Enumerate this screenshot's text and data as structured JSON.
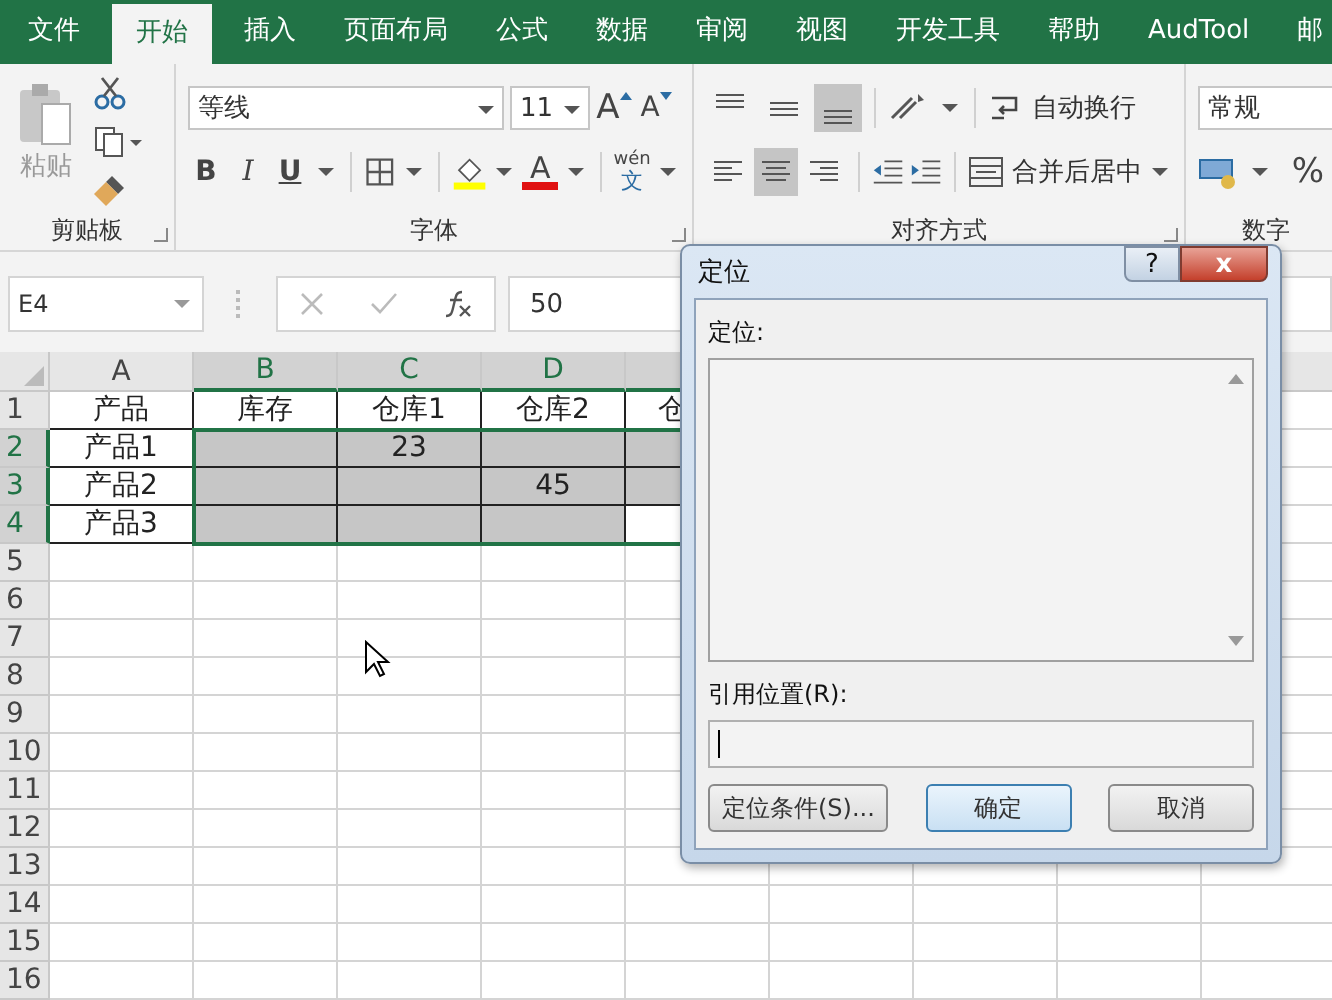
{
  "tabs": [
    {
      "label": "文件",
      "selected": false
    },
    {
      "label": "开始",
      "selected": true
    },
    {
      "label": "插入",
      "selected": false
    },
    {
      "label": "页面布局",
      "selected": false
    },
    {
      "label": "公式",
      "selected": false
    },
    {
      "label": "数据",
      "selected": false
    },
    {
      "label": "审阅",
      "selected": false
    },
    {
      "label": "视图",
      "selected": false
    },
    {
      "label": "开发工具",
      "selected": false
    },
    {
      "label": "帮助",
      "selected": false
    },
    {
      "label": "AudTool",
      "selected": false
    },
    {
      "label": "邮",
      "selected": false
    }
  ],
  "ribbon": {
    "clipboard": {
      "label": "剪贴板",
      "paste": "粘贴"
    },
    "font": {
      "label": "字体",
      "font_name": "等线",
      "font_size": "11",
      "grow": "A",
      "shrink": "A",
      "bold": "B",
      "italic": "I",
      "underline": "U",
      "font_color": "A",
      "phonetic_top": "wén",
      "phonetic_bottom": "文"
    },
    "alignment": {
      "label": "对齐方式",
      "vertical": [
        {
          "kind": "top",
          "selected": false
        },
        {
          "kind": "middle",
          "selected": false
        },
        {
          "kind": "bottom",
          "selected": true
        }
      ],
      "horizontal": [
        {
          "kind": "left",
          "selected": false
        },
        {
          "kind": "center",
          "selected": true
        },
        {
          "kind": "right",
          "selected": false
        }
      ],
      "wrap": "自动换行",
      "merge": "合并后居中"
    },
    "number": {
      "label": "数字",
      "format": "常规",
      "percent": "%"
    }
  },
  "formula_bar": {
    "name_box": "E4",
    "value": "50"
  },
  "columns": [
    {
      "label": "A",
      "selected": false
    },
    {
      "label": "B",
      "selected": true
    },
    {
      "label": "C",
      "selected": true
    },
    {
      "label": "D",
      "selected": true
    },
    {
      "selected": true
    }
  ],
  "rows": [
    {
      "number": "1",
      "selected": false,
      "cells": [
        {
          "text": "产品",
          "selected": false
        },
        {
          "text": "库存",
          "selected": false
        },
        {
          "text": "仓库1",
          "selected": false
        },
        {
          "text": "仓库2",
          "selected": false
        },
        {
          "text": "仓",
          "selected": false
        }
      ]
    },
    {
      "number": "2",
      "selected": true,
      "cells": [
        {
          "text": "产品1",
          "selected": false
        },
        {
          "selected": true
        },
        {
          "text": "23",
          "selected": true
        },
        {
          "selected": true
        },
        {
          "selected": true
        }
      ]
    },
    {
      "number": "3",
      "selected": true,
      "cells": [
        {
          "text": "产品2",
          "selected": false
        },
        {
          "selected": true
        },
        {
          "selected": true
        },
        {
          "text": "45",
          "selected": true
        },
        {
          "selected": true
        }
      ]
    },
    {
      "number": "4",
      "selected": true,
      "cells": [
        {
          "text": "产品3",
          "selected": false
        },
        {
          "selected": true
        },
        {
          "selected": true
        },
        {
          "selected": true
        },
        {
          "selected": false
        }
      ]
    },
    {
      "number": "5",
      "selected": false
    },
    {
      "number": "6",
      "selected": false
    },
    {
      "number": "7",
      "selected": false
    },
    {
      "number": "8",
      "selected": false
    },
    {
      "number": "9",
      "selected": false
    },
    {
      "number": "10",
      "selected": false
    },
    {
      "number": "11",
      "selected": false
    },
    {
      "number": "12",
      "selected": false
    },
    {
      "number": "13",
      "selected": false
    },
    {
      "number": "14",
      "selected": false
    },
    {
      "number": "15",
      "selected": false
    },
    {
      "number": "16",
      "selected": false
    }
  ],
  "dialog": {
    "title": "定位",
    "help": "?",
    "close": "x",
    "list_label": "定位:",
    "reference_label": "引用位置(R):",
    "special_button": "定位条件(S)...",
    "ok_button": "确定",
    "cancel_button": "取消"
  }
}
